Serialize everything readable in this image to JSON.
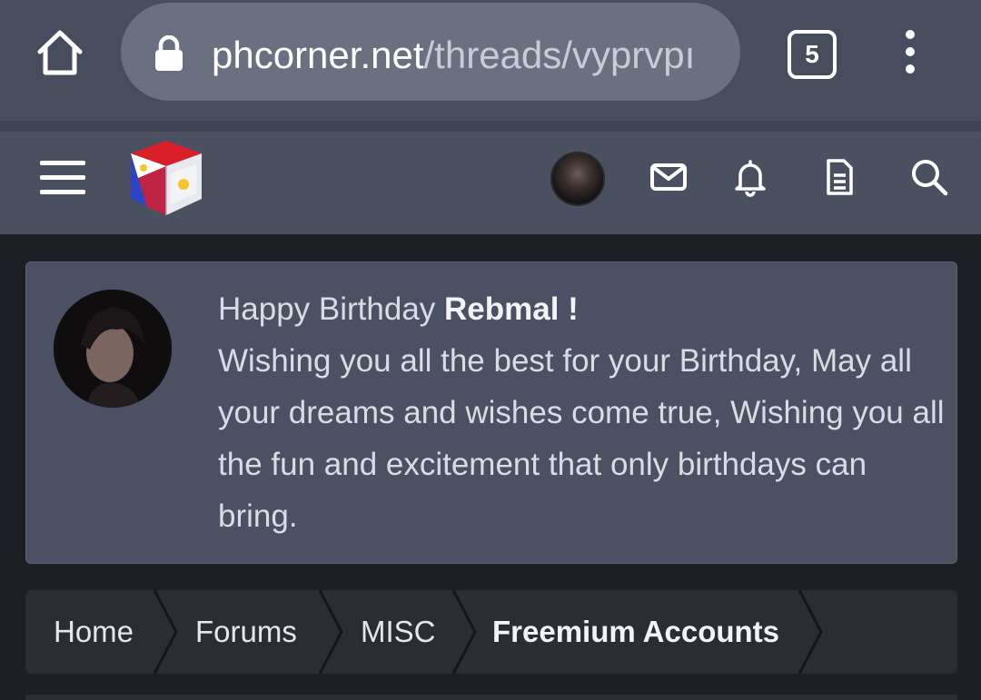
{
  "browser": {
    "url_host": "phcorner.net",
    "url_path": "/threads/vyprvpı",
    "tab_count": "5",
    "icons": {
      "home": "home-icon",
      "lock": "lock-icon",
      "menu": "kebab-menu-icon"
    }
  },
  "site_header": {
    "icons": [
      "hamburger-icon",
      "logo",
      "avatar",
      "mail-icon",
      "bell-icon",
      "document-icon",
      "search-icon"
    ]
  },
  "notice": {
    "greeting": "Happy Birthday ",
    "username": "Rebmal !",
    "message": "Wishing you all the best for your Birthday, May all your dreams and wishes come true, Wishing you all the fun and excitement that only birthdays can bring."
  },
  "breadcrumb": {
    "items": [
      "Home",
      "Forums",
      "MISC",
      "Freemium Accounts"
    ]
  },
  "colors": {
    "browser_bar": "#474d5c",
    "url_pill": "#6a7080",
    "site_header": "#4a5060",
    "notice_bg": "#4b5163",
    "breadcrumb_bg": "#2b2d35",
    "page_bg": "#1e1f24"
  }
}
